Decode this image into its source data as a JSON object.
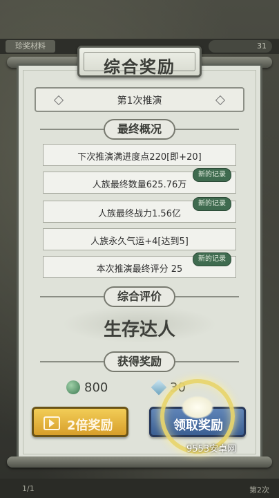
{
  "background": {
    "tag_label": "珍奖材料",
    "count_label": "31",
    "page_indicator": "1/1",
    "times_label": "第2次"
  },
  "dialog": {
    "title": "综合奖励",
    "round_label": "第1次推演",
    "sections": {
      "final_status": "最终概况",
      "overall_rating": "综合评价",
      "rewards": "获得奖励"
    },
    "stats": [
      {
        "text": "下次推演满进度点220[即+20]",
        "badge": ""
      },
      {
        "text": "人族最终数量625.76万",
        "badge": "新的记录"
      },
      {
        "text": "人族最终战力1.56亿",
        "badge": "新的记录"
      },
      {
        "text": "人族永久气运+4[达到5]",
        "badge": ""
      },
      {
        "text": "本次推演最终评分 25",
        "badge": "新的记录"
      }
    ],
    "verdict": "生存达人",
    "rewards": [
      {
        "icon": "jade-coin-icon",
        "amount": "800"
      },
      {
        "icon": "crystal-icon",
        "amount": "30"
      }
    ],
    "buttons": {
      "double": "2倍奖励",
      "claim": "领取奖励"
    }
  },
  "watermark": "9553安卓网",
  "colors": {
    "double_button": "#e5b540",
    "claim_button": "#4a6fa5",
    "badge": "#3f6b4f"
  }
}
